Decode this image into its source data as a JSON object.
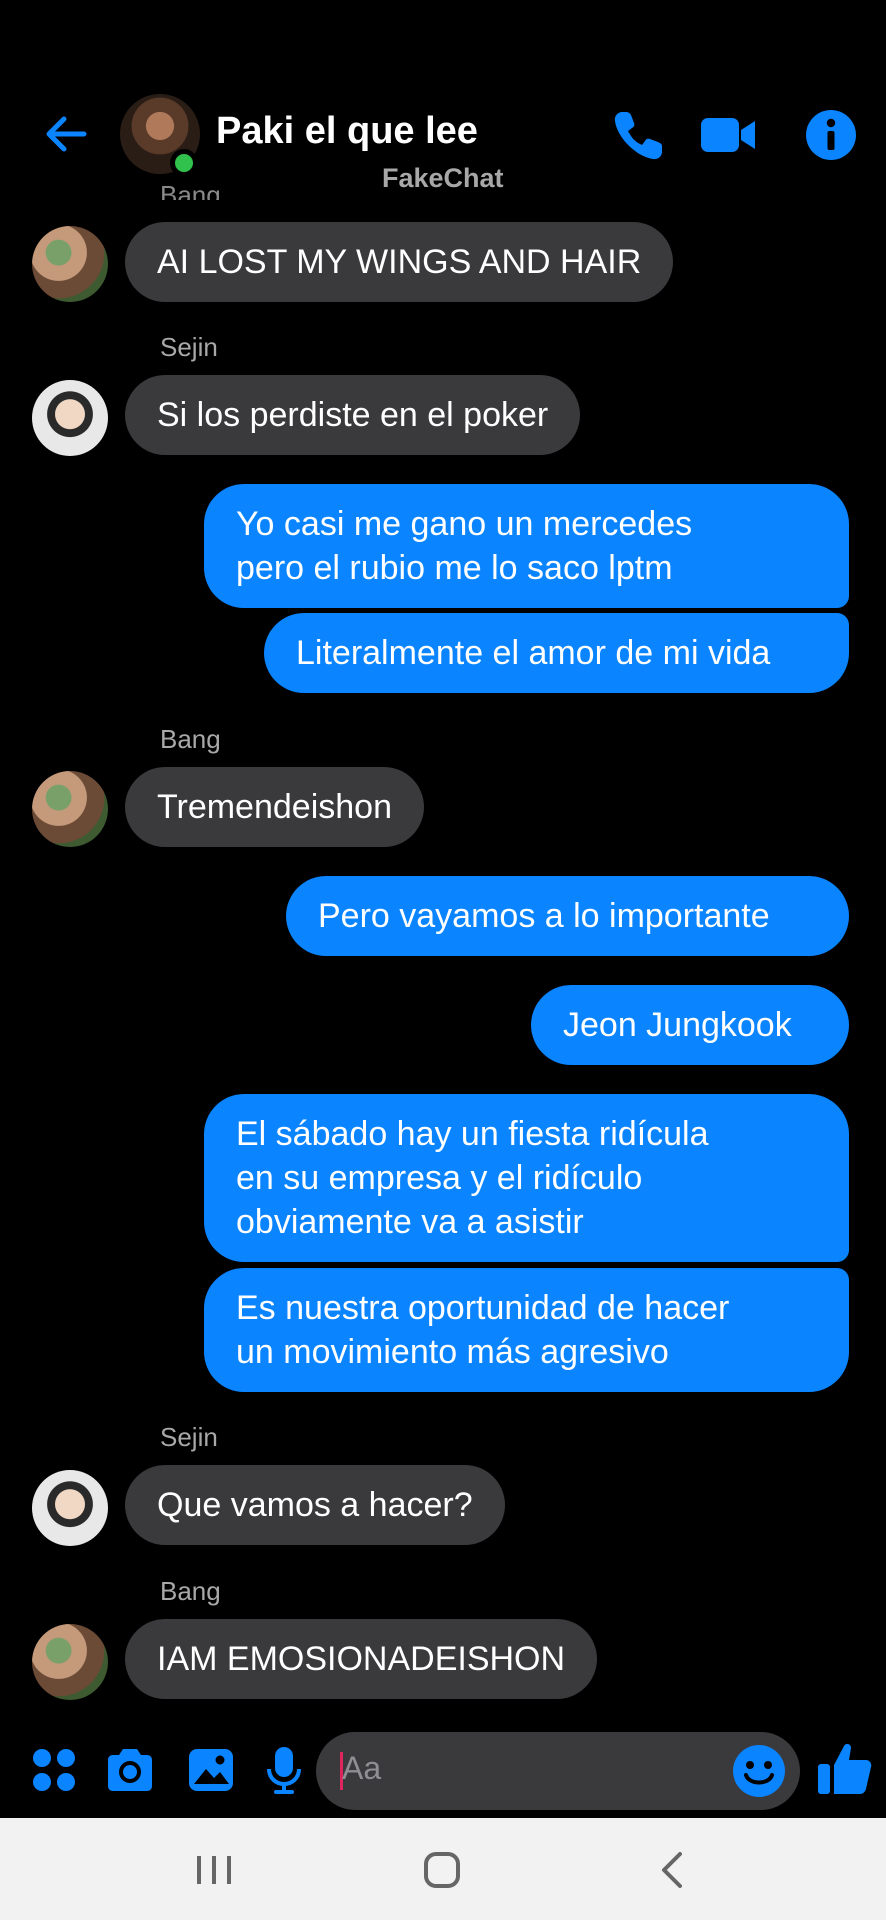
{
  "header": {
    "contact_name": "Paki el que lee",
    "watermark": "FakeChat",
    "peek_sender": "Bang",
    "accent_color": "#0a84ff",
    "icons": [
      "back-arrow-icon",
      "phone-icon",
      "video-camera-icon",
      "info-icon"
    ]
  },
  "messages": [
    {
      "type": "in",
      "text": "AI LOST MY WINGS AND HAIR"
    },
    {
      "type": "sender",
      "text": "Sejin"
    },
    {
      "type": "in",
      "text": "Si los perdiste en el poker"
    },
    {
      "type": "out",
      "text": "Yo casi me gano un mercedes\npero el rubio me lo saco lptm"
    },
    {
      "type": "out",
      "text": "Literalmente el amor de mi vida"
    },
    {
      "type": "sender",
      "text": "Bang"
    },
    {
      "type": "in",
      "text": "Tremendeishon"
    },
    {
      "type": "out",
      "text": "Pero vayamos a lo importante"
    },
    {
      "type": "out",
      "text": "Jeon Jungkook"
    },
    {
      "type": "out",
      "text": "El sábado hay un fiesta ridícula\nen su empresa y el ridículo\nobviamente va a asistir"
    },
    {
      "type": "out",
      "text": "Es nuestra oportunidad de hacer\nun movimiento más agresivo"
    },
    {
      "type": "sender",
      "text": "Sejin"
    },
    {
      "type": "in",
      "text": "Que vamos a hacer?"
    },
    {
      "type": "sender",
      "text": "Bang"
    },
    {
      "type": "in",
      "text": "IAM EMOSIONADEISHON"
    }
  ],
  "composer": {
    "placeholder": "Aa",
    "icons": [
      "apps-grid-icon",
      "camera-icon",
      "image-icon",
      "microphone-icon",
      "emoji-icon",
      "thumbs-up-icon"
    ]
  },
  "navbar": {
    "icons": [
      "recent-apps-icon",
      "home-icon",
      "back-icon"
    ],
    "background": "#f2f2f2"
  }
}
